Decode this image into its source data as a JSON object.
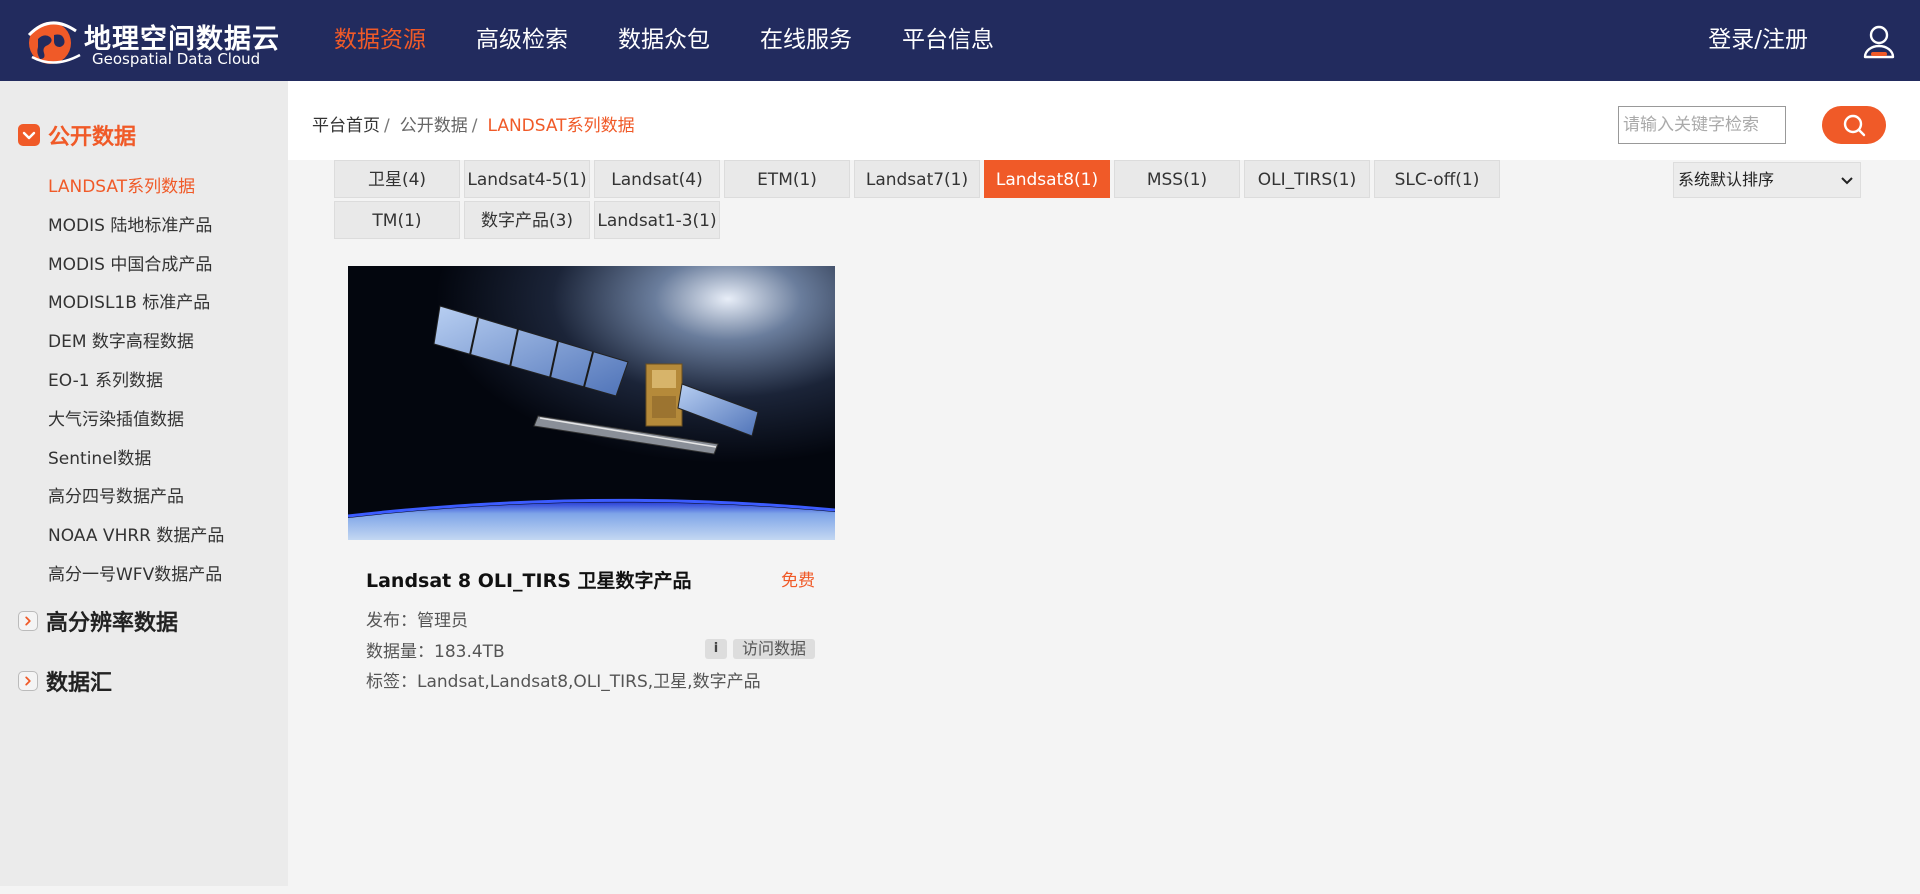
{
  "header": {
    "logo_cn": "地理空间数据云",
    "logo_en": "Geospatial Data Cloud",
    "nav": [
      "数据资源",
      "高级检索",
      "数据众包",
      "在线服务",
      "平台信息"
    ],
    "login_label": "登录/注册",
    "user_icon": "user-icon",
    "brand_color": "#222b5e",
    "accent_color": "#f05a28"
  },
  "sidebar": {
    "sections": [
      {
        "label": "公开数据",
        "expanded": true,
        "icon": "chevron-down-icon"
      },
      {
        "label": "高分辨率数据",
        "expanded": false,
        "icon": "chevron-right-icon"
      },
      {
        "label": "数据汇",
        "expanded": false,
        "icon": "chevron-right-icon"
      }
    ],
    "items": [
      "LANDSAT系列数据",
      "MODIS 陆地标准产品",
      "MODIS 中国合成产品",
      "MODISL1B 标准产品",
      "DEM 数字高程数据",
      "EO-1 系列数据",
      "大气污染插值数据",
      "Sentinel数据",
      "高分四号数据产品",
      "NOAA VHRR 数据产品",
      "高分一号WFV数据产品"
    ],
    "active_item": "LANDSAT系列数据"
  },
  "breadcrumb": {
    "items": [
      "平台首页",
      "公开数据",
      "LANDSAT系列数据"
    ],
    "separator": "/"
  },
  "search": {
    "placeholder": "请输入关键字检索",
    "value": ""
  },
  "tags": [
    "卫星(4)",
    "Landsat4-5(1)",
    "Landsat(4)",
    "ETM(1)",
    "Landsat7(1)",
    "Landsat8(1)",
    "MSS(1)",
    "OLI_TIRS(1)",
    "SLC-off(1)",
    "TM(1)",
    "数字产品(3)",
    "Landsat1-3(1)"
  ],
  "active_tag": "Landsat8(1)",
  "sort": {
    "selected": "系统默认排序"
  },
  "card": {
    "title": "Landsat 8 OLI_TIRS 卫星数字产品",
    "price": "免费",
    "publisher_label": "发布：",
    "publisher": "管理员",
    "size_label": "数据量：",
    "size": "183.4TB",
    "tags_label": "标签：",
    "tags": "Landsat,Landsat8,OLI_TIRS,卫星,数字产品",
    "info_label": "i",
    "visit_label": "访问数据"
  }
}
